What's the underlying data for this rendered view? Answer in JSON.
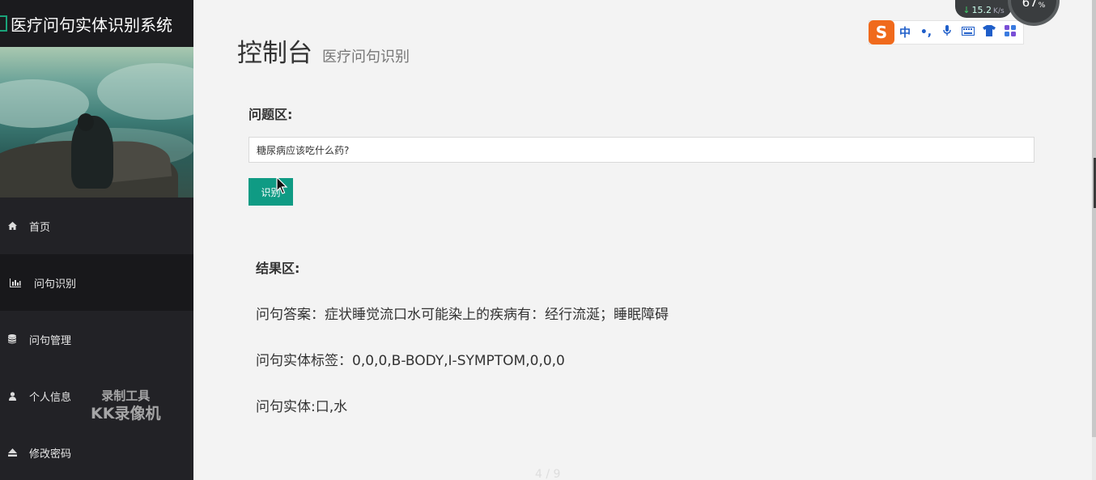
{
  "sidebar": {
    "brand_title": "医疗问句实体识别系统",
    "items": [
      {
        "label": "首页",
        "icon": "home-icon"
      },
      {
        "label": "问句识别",
        "icon": "bar-chart-icon"
      },
      {
        "label": "问句管理",
        "icon": "database-icon"
      },
      {
        "label": "个人信息",
        "icon": "user-icon"
      },
      {
        "label": "修改密码",
        "icon": "eject-icon"
      }
    ],
    "active_index": 1
  },
  "watermark": {
    "line1": "录制工具",
    "line2": "KK录像机"
  },
  "header": {
    "title": "控制台",
    "subtitle": "医疗问句识别"
  },
  "question": {
    "label": "问题区:",
    "value": "糖尿病应该吃什么药?",
    "button_label": "识别"
  },
  "result": {
    "label": "结果区:",
    "answer": "问句答案：症状睡觉流口水可能染上的疾病有：经行流涎；睡眠障碍",
    "tags": "问句实体标签：0,0,0,B-BODY,I-SYMPTOM,0,0,0",
    "entities": "问句实体:口,水"
  },
  "pager": {
    "text": "4 / 9"
  },
  "ime": {
    "logo": "S",
    "items": [
      "中",
      "•,",
      "🎤",
      "⌨",
      "👕",
      "▦"
    ]
  },
  "system_widgets": {
    "net_speed": "15.2",
    "net_unit": "K/s",
    "memory": "67",
    "memory_unit": "%"
  },
  "colors": {
    "sidebar_bg": "#222226",
    "accent": "#0f9b84",
    "main_bg": "#f3f3f3"
  }
}
